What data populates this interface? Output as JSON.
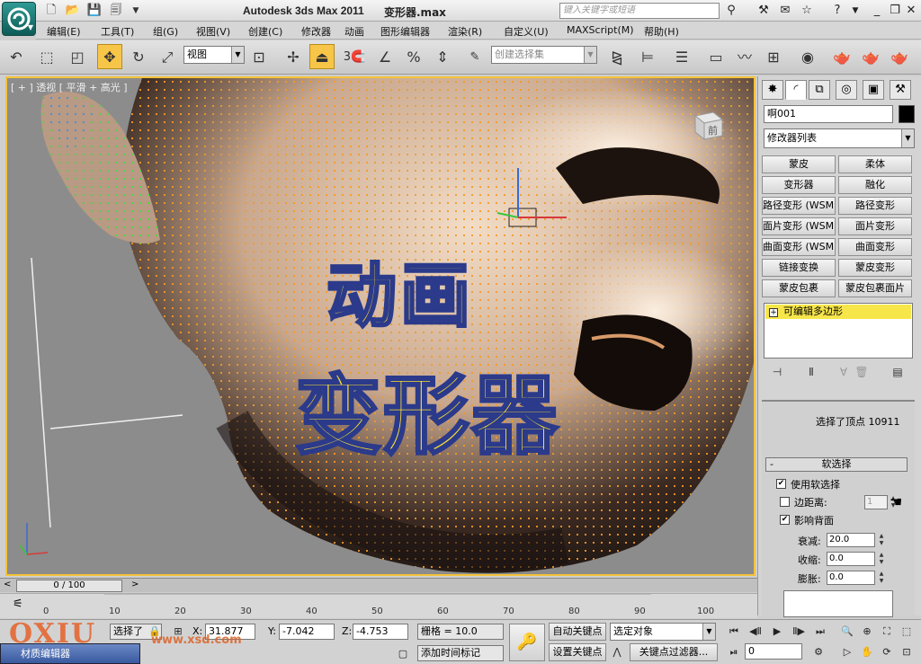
{
  "window": {
    "app_title": "Autodesk 3ds Max  2011",
    "file_name": "变形器.max",
    "search_placeholder": "键入关键字或短语"
  },
  "menu": [
    "编辑(E)",
    "工具(T)",
    "组(G)",
    "视图(V)",
    "创建(C)",
    "修改器",
    "动画",
    "图形编辑器",
    "渲染(R)",
    "自定义(U)",
    "MAXScript(M)",
    "帮助(H)"
  ],
  "toolbar": {
    "view_dropdown": "视图",
    "named_selection": "创建选择集",
    "snap_label": "3"
  },
  "viewport": {
    "label": "[ + ] 透视 [ 平滑 + 高光 ]",
    "overlay_line1": "动画",
    "overlay_line2": "变形器",
    "viewcube_label": "前"
  },
  "command_panel": {
    "object_name": "啊001",
    "modifier_list": "修改器列表",
    "modifier_buttons": [
      "蒙皮",
      "柔体",
      "变形器",
      "融化",
      "路径变形 (WSM)",
      "路径变形",
      "面片变形 (WSM)",
      "面片变形",
      "曲面变形 (WSM)",
      "曲面变形",
      "链接变换",
      "蒙皮变形",
      "蒙皮包裹",
      "蒙皮包裹面片"
    ],
    "stack_item": "可编辑多边形",
    "selection_text": "选择了顶点 10911",
    "soft_selection": {
      "title": "软选择",
      "use_soft": "使用软选择",
      "edge_distance": "边距离:",
      "edge_distance_value": "1",
      "affect_backfacing": "影响背面",
      "falloff_label": "衰减:",
      "falloff_value": "20.0",
      "pinch_label": "收缩:",
      "pinch_value": "0.0",
      "bubble_label": "膨胀:",
      "bubble_value": "0.0"
    }
  },
  "timeline": {
    "position": "0 / 100",
    "ticks": [
      "0",
      "10",
      "20",
      "30",
      "40",
      "50",
      "60",
      "70",
      "80",
      "90",
      "100"
    ]
  },
  "status": {
    "selected": "选择了",
    "x_label": "X:",
    "x_value": "31.877",
    "y_label": "Y:",
    "y_value": "-7.042",
    "z_label": "Z:",
    "z_value": "-4.753",
    "grid": "栅格 = 10.0",
    "add_time_tag": "添加时间标记",
    "auto_key": "自动关键点",
    "selected_object": "选定对象",
    "set_key": "设置关键点",
    "key_filters": "关键点过滤器...",
    "frame_value": "0",
    "taskbar_text": "材质编辑器",
    "watermark": "OXIU",
    "watermark_url": "www.xsd.com"
  },
  "colors": {
    "accent": "#f4c33a",
    "overlay_fill": "#ffe230",
    "overlay_stroke": "#2b3a8a",
    "stack_highlight": "#f7e64a"
  }
}
